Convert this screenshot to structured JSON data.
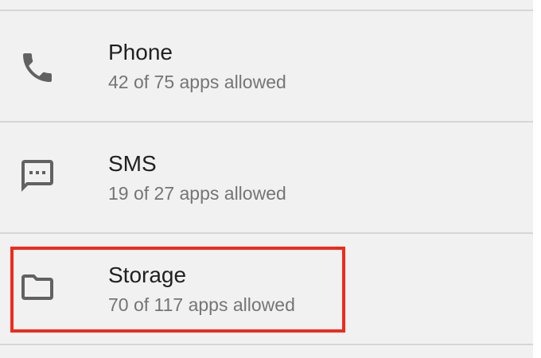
{
  "permissions": {
    "items": [
      {
        "title": "Phone",
        "subtitle": "42 of 75 apps allowed",
        "icon": "phone-icon"
      },
      {
        "title": "SMS",
        "subtitle": "19 of 27 apps allowed",
        "icon": "sms-icon"
      },
      {
        "title": "Storage",
        "subtitle": "70 of 117 apps allowed",
        "icon": "folder-icon"
      }
    ]
  },
  "colors": {
    "background": "#f1f1f1",
    "title": "#212121",
    "subtitle": "#757575",
    "icon": "#616161",
    "divider": "#d6d6d6",
    "highlight_outline": "#f12a1b"
  }
}
